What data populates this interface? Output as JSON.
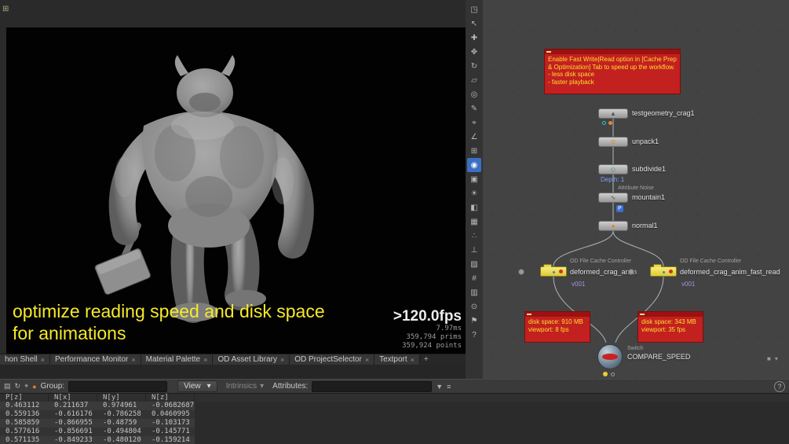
{
  "viewport": {
    "caption_line1": "optimize reading speed and disk space",
    "caption_line2": "for animations",
    "stats": {
      "fps": ">120.0fps",
      "ms": "7.97ms",
      "prims": "359,794  prims",
      "points": "359,924 points"
    }
  },
  "viewport_toolbar": {
    "icons": [
      {
        "name": "pane-layout-icon",
        "glyph": "◳"
      },
      {
        "name": "select-tool-icon",
        "glyph": "↖"
      },
      {
        "name": "add-tool-icon",
        "glyph": "✚"
      },
      {
        "name": "move-tool-icon",
        "glyph": "✥"
      },
      {
        "name": "rotate-tool-icon",
        "glyph": "↻"
      },
      {
        "name": "scale-tool-icon",
        "glyph": "▱"
      },
      {
        "name": "handle-tool-icon",
        "glyph": "◎"
      },
      {
        "name": "draw-tool-icon",
        "glyph": "✎"
      },
      {
        "name": "snap-tool-icon",
        "glyph": "⌖"
      },
      {
        "name": "measure-tool-icon",
        "glyph": "∠"
      },
      {
        "name": "grid-snap-icon",
        "glyph": "⊞"
      },
      {
        "name": "view-tool-icon",
        "glyph": "◉",
        "active": true
      },
      {
        "name": "camera-tool-icon",
        "glyph": "▣"
      },
      {
        "name": "light-tool-icon",
        "glyph": "☀"
      },
      {
        "name": "shading-mode-icon",
        "glyph": "◧"
      },
      {
        "name": "wireframe-mode-icon",
        "glyph": "▦"
      },
      {
        "name": "points-display-icon",
        "glyph": "∴"
      },
      {
        "name": "normals-display-icon",
        "glyph": "⊥"
      },
      {
        "name": "background-display-icon",
        "glyph": "▨"
      },
      {
        "name": "grid-display-icon",
        "glyph": "#"
      },
      {
        "name": "memory-display-icon",
        "glyph": "▥"
      },
      {
        "name": "center-view-icon",
        "glyph": "⊙"
      },
      {
        "name": "flag-icon",
        "glyph": "⚑"
      },
      {
        "name": "viewport-help-icon",
        "glyph": "?"
      }
    ]
  },
  "corner": {
    "glyph": "⊞"
  },
  "network": {
    "sticky_note": {
      "text": "Enable Fast Write|Read option in [Cache Prep & Optimization] Tab to speed up the workflow.",
      "line1": "- less disk space",
      "line2": "- faster playback"
    },
    "nodes": {
      "crag": {
        "label": "testgeometry_crag1",
        "glyph": "▲"
      },
      "unpack": {
        "label": "unpack1",
        "glyph": "≣"
      },
      "subdivide": {
        "label": "subdivide1",
        "glyph": "◇",
        "info": "Depth: 1"
      },
      "mountain": {
        "label": "mountain1",
        "glyph": "∿",
        "type_header": "Attribute Noise",
        "badge": "P"
      },
      "normal": {
        "label": "normal1",
        "glyph": "●"
      },
      "cache_left": {
        "label": "deformed_crag_anim",
        "type_header": "OD File Cache Controller",
        "version": "v001"
      },
      "cache_right": {
        "label": "deformed_crag_anim_fast_read",
        "type_header": "OD File Cache Controller",
        "version": "v001"
      },
      "switch": {
        "label": "COMPARE_SPEED",
        "type_header": "Switch"
      }
    },
    "notes": {
      "left_line1": "disk space: 910 MB",
      "left_line2": "viewport: 8 fps",
      "right_line1": "disk space: 343 MB",
      "right_line2": "viewport: 35 fps"
    },
    "corner_icons": {
      "square": "■",
      "menu": "▾"
    }
  },
  "tabs": {
    "items": [
      {
        "label": "hon Shell"
      },
      {
        "label": "Performance Monitor"
      },
      {
        "label": "Material Palette"
      },
      {
        "label": "OD Asset Library"
      },
      {
        "label": "OD ProjectSelector"
      },
      {
        "label": "Textport"
      }
    ],
    "close_glyph": "×",
    "new_tab_glyph": "+"
  },
  "spreadsheet": {
    "toolbar": {
      "icons": [
        {
          "name": "spreadsheet-pane-icon",
          "glyph": "▤"
        },
        {
          "name": "refresh-icon",
          "glyph": "↻"
        },
        {
          "name": "pin-icon",
          "glyph": "⌖"
        },
        {
          "name": "node-link-icon",
          "glyph": "●"
        }
      ],
      "group_label": "Group:",
      "group_value": "",
      "view_button": "View",
      "dropdown_glyph": "▾",
      "intrinsics_label": "Intrinsics",
      "attributes_label": "Attributes:",
      "attributes_value": "",
      "filter_glyph": "▼",
      "sort_glyph": "≡",
      "help_glyph": "?"
    },
    "columns": [
      "P[z]",
      "N[x]",
      "N[y]",
      "N[z]"
    ],
    "rows": [
      [
        "0.463112",
        "0.211637",
        "0.974961",
        "-0.0682687"
      ],
      [
        "0.559136",
        "-0.616176",
        "-0.786258",
        "0.0460995"
      ],
      [
        "0.585859",
        "-0.866955",
        "-0.48759",
        "-0.103173"
      ],
      [
        "0.577616",
        "-0.856691",
        "-0.494804",
        "-0.145771"
      ],
      [
        "0.571135",
        "-0.849233",
        "-0.480120",
        "-0.159214"
      ]
    ]
  }
}
